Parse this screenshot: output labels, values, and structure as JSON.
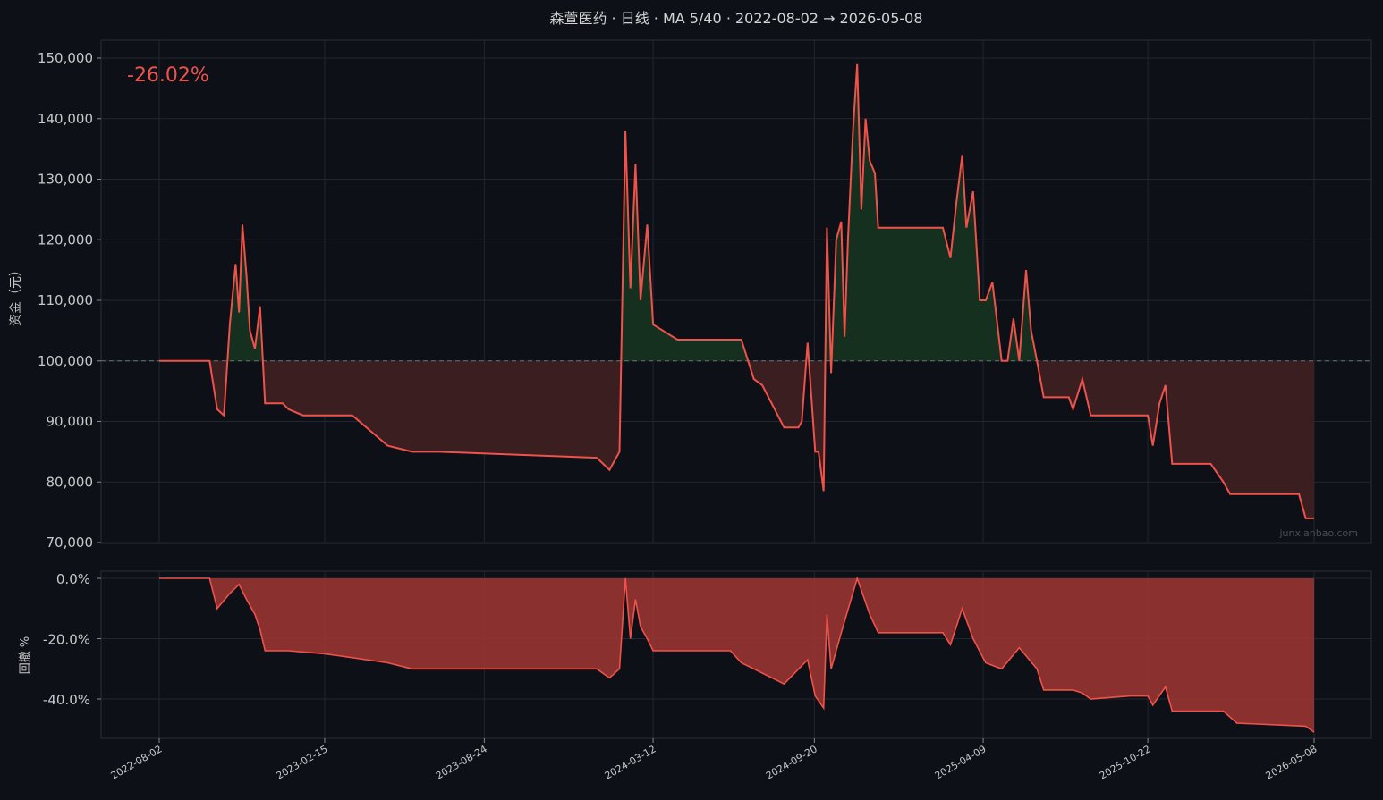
{
  "chart_data": {
    "type": "line",
    "title": "森萱医药 · 日线 · MA 5/40 · 2022-08-02 → 2026-05-08",
    "return_label": "-26.02%",
    "watermark": "junxianbao.com",
    "colors": {
      "background": "#0d1017",
      "line": "#f0524a",
      "gain_fill": "#15301f",
      "loss_fill": "#3a1e20",
      "drawdown_fill": "#a13632",
      "baseline": "#5b7a72",
      "grid": "#23262e",
      "text": "#c8c8c8"
    },
    "equity": {
      "ylabel": "资金（元）",
      "baseline": 100000,
      "ylim": [
        70000,
        150000
      ],
      "yticks": [
        70000,
        80000,
        90000,
        100000,
        110000,
        120000,
        130000,
        140000,
        150000
      ],
      "ytick_labels": [
        "70,000",
        "80,000",
        "90,000",
        "100,000",
        "110,000",
        "120,000",
        "130,000",
        "140,000",
        "150,000"
      ],
      "x": [
        "2022-08-02",
        "2022-10-01",
        "2022-10-10",
        "2022-10-18",
        "2022-10-25",
        "2022-11-01",
        "2022-11-05",
        "2022-11-09",
        "2022-11-14",
        "2022-11-18",
        "2022-11-24",
        "2022-11-30",
        "2022-12-06",
        "2022-12-14",
        "2022-12-20",
        "2022-12-27",
        "2023-01-03",
        "2023-01-20",
        "2023-02-15",
        "2023-03-20",
        "2023-05-01",
        "2023-05-30",
        "2023-06-20",
        "2023-07-01",
        "2024-01-05",
        "2024-01-20",
        "2024-02-01",
        "2024-02-08",
        "2024-02-14",
        "2024-02-20",
        "2024-02-26",
        "2024-03-05",
        "2024-03-12",
        "2024-04-10",
        "2024-05-05",
        "2024-06-12",
        "2024-06-25",
        "2024-07-10",
        "2024-07-20",
        "2024-08-15",
        "2024-08-25",
        "2024-09-01",
        "2024-09-05",
        "2024-09-12",
        "2024-09-21",
        "2024-09-25",
        "2024-10-01",
        "2024-10-05",
        "2024-10-10",
        "2024-10-16",
        "2024-10-22",
        "2024-10-26",
        "2024-10-30",
        "2024-11-05",
        "2024-11-10",
        "2024-11-15",
        "2024-11-20",
        "2024-11-25",
        "2024-12-01",
        "2024-12-05",
        "2025-01-10",
        "2025-02-10",
        "2025-02-20",
        "2025-03-01",
        "2025-03-08",
        "2025-03-15",
        "2025-03-20",
        "2025-03-28",
        "2025-04-05",
        "2025-04-12",
        "2025-04-20",
        "2025-05-01",
        "2025-05-08",
        "2025-05-15",
        "2025-05-22",
        "2025-05-30",
        "2025-06-05",
        "2025-06-12",
        "2025-06-20",
        "2025-07-10",
        "2025-07-20",
        "2025-07-25",
        "2025-08-05",
        "2025-08-15",
        "2025-08-25",
        "2025-09-01",
        "2025-10-01",
        "2025-10-22",
        "2025-10-28",
        "2025-11-05",
        "2025-11-12",
        "2025-11-20",
        "2025-12-01",
        "2025-12-15",
        "2026-01-05",
        "2026-01-20",
        "2026-01-28",
        "2026-02-05",
        "2026-02-15",
        "2026-03-10",
        "2026-04-01",
        "2026-04-20",
        "2026-04-28",
        "2026-05-08"
      ],
      "y": [
        100000,
        100000,
        92000,
        91000,
        106000,
        116000,
        108000,
        122500,
        114000,
        105000,
        102000,
        109000,
        93000,
        93000,
        93000,
        93000,
        92000,
        91000,
        91000,
        91000,
        86000,
        85000,
        85000,
        85000,
        84000,
        82000,
        85000,
        138000,
        112000,
        132500,
        110000,
        122500,
        106000,
        103500,
        103500,
        103500,
        103500,
        97000,
        96000,
        89000,
        89000,
        89000,
        90000,
        103000,
        85000,
        85000,
        78500,
        122000,
        98000,
        120000,
        123000,
        104000,
        120000,
        138000,
        149000,
        125000,
        140000,
        133000,
        131000,
        122000,
        122000,
        122000,
        122000,
        117000,
        126000,
        134000,
        122000,
        128000,
        110000,
        110000,
        113000,
        100000,
        100000,
        107000,
        100000,
        115000,
        105000,
        100000,
        94000,
        94000,
        94000,
        92000,
        97000,
        91000,
        91000,
        91000,
        91000,
        91000,
        86000,
        93000,
        96000,
        83000,
        83000,
        83000,
        83000,
        80000,
        78000,
        78000,
        78000,
        78000,
        78000,
        78000,
        74000,
        74000
      ]
    },
    "drawdown": {
      "ylabel": "回撤 %",
      "ylim": [
        -53,
        3
      ],
      "yticks": [
        0,
        -20,
        -40
      ],
      "ytick_labels": [
        "0.0%",
        "-20.0%",
        "-40.0%"
      ],
      "x": [
        "2022-08-02",
        "2022-10-01",
        "2022-10-10",
        "2022-10-25",
        "2022-11-05",
        "2022-11-14",
        "2022-11-24",
        "2022-11-30",
        "2022-12-06",
        "2023-01-03",
        "2023-02-15",
        "2023-05-01",
        "2023-05-30",
        "2023-07-01",
        "2024-01-05",
        "2024-01-20",
        "2024-02-01",
        "2024-02-08",
        "2024-02-14",
        "2024-02-20",
        "2024-02-26",
        "2024-03-05",
        "2024-03-12",
        "2024-05-05",
        "2024-06-12",
        "2024-06-25",
        "2024-07-10",
        "2024-08-15",
        "2024-09-12",
        "2024-09-21",
        "2024-10-01",
        "2024-10-05",
        "2024-10-10",
        "2024-10-22",
        "2024-11-10",
        "2024-11-25",
        "2024-12-05",
        "2025-02-20",
        "2025-03-01",
        "2025-03-15",
        "2025-03-28",
        "2025-04-12",
        "2025-05-01",
        "2025-05-22",
        "2025-06-12",
        "2025-06-20",
        "2025-07-25",
        "2025-08-05",
        "2025-08-15",
        "2025-10-01",
        "2025-10-22",
        "2025-10-28",
        "2025-11-12",
        "2025-11-20",
        "2025-12-15",
        "2026-01-20",
        "2026-01-28",
        "2026-02-05",
        "2026-04-28",
        "2026-05-08"
      ],
      "y": [
        0,
        0,
        -10,
        -5,
        -2,
        -7,
        -12,
        -17,
        -24,
        -24,
        -25,
        -28,
        -30,
        -30,
        -30,
        -33,
        -30,
        0,
        -20,
        -7,
        -16,
        -20,
        -24,
        -24,
        -24,
        -28,
        -30,
        -35,
        -27,
        -39,
        -43,
        -12,
        -30,
        -18,
        0,
        -12,
        -18,
        -18,
        -22,
        -10,
        -20,
        -28,
        -30,
        -23,
        -30,
        -37,
        -37,
        -38,
        -40,
        -39,
        -39,
        -42,
        -36,
        -44,
        -44,
        -44,
        -46,
        -48,
        -49,
        -51
      ]
    },
    "x_tick_labels": [
      "2022-08-02",
      "2023-02-15",
      "2023-08-24",
      "2024-03-12",
      "2024-09-20",
      "2025-04-09",
      "2025-10-22",
      "2026-05-08"
    ]
  }
}
